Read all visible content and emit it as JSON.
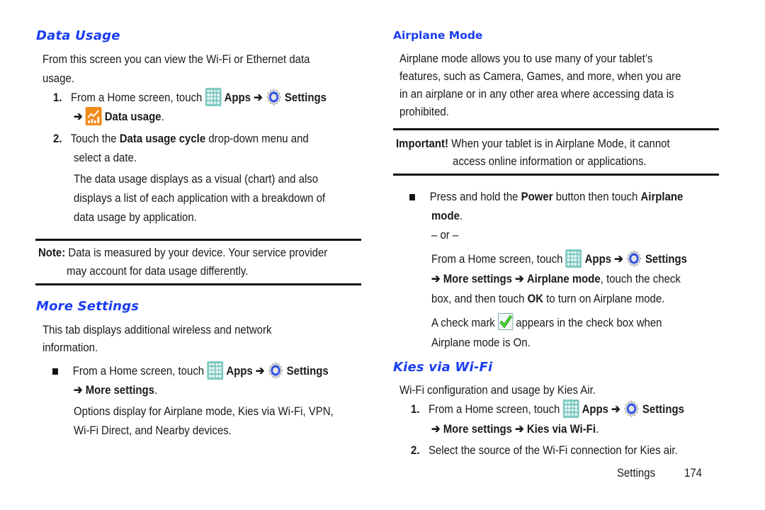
{
  "left": {
    "data_usage": {
      "heading": "Data Usage",
      "intro_line1": "From this screen you can view the Wi-Fi or Ethernet data",
      "intro_line2": "usage.",
      "step1": {
        "num": "1.",
        "pre": "From a Home screen, touch",
        "apps": "Apps",
        "arrow": "➔",
        "settings": "Settings",
        "data_usage": "Data usage",
        "period": "."
      },
      "step2": {
        "num": "2.",
        "pre": "Touch the",
        "bold": "Data usage cycle",
        "post": "drop-down menu and",
        "line2": "select a date."
      },
      "para_lines": [
        "The data usage displays as a visual (chart) and also",
        "displays a list of each application with a breakdown of",
        "data usage by application."
      ]
    },
    "note": {
      "label": "Note:",
      "line1": "Data is measured by your device. Your service provider",
      "line2": "may account for data usage differently."
    },
    "more_settings": {
      "heading": "More Settings",
      "intro_line1": "This tab displays additional wireless and network",
      "intro_line2": "information.",
      "bullet": {
        "pre": "From a Home screen, touch",
        "apps": "Apps",
        "arrow": "➔",
        "settings": "Settings",
        "more": "More settings",
        "period": "."
      },
      "para_lines": [
        "Options display for Airplane mode, Kies via Wi-Fi, VPN,",
        "Wi-Fi Direct, and Nearby devices."
      ]
    }
  },
  "right": {
    "airplane": {
      "heading": "Airplane Mode",
      "para_lines": [
        "Airplane mode allows you to use many of your tablet’s",
        "features, such as Camera, Games, and more, when you are",
        "in an airplane or in any other area where accessing data is",
        "prohibited."
      ]
    },
    "important": {
      "label": "Important!",
      "line1": "When your tablet is in Airplane Mode, it cannot",
      "line2": "access online information or applications."
    },
    "bullet": {
      "pre": "Press and hold the",
      "power": "Power",
      "mid": "button then touch",
      "airplane": "Airplane",
      "mode": "mode",
      "period": "."
    },
    "or": "– or –",
    "alt": {
      "pre": "From a Home screen, touch",
      "apps": "Apps",
      "arrow": "➔",
      "settings": "Settings",
      "more": "More settings",
      "airplane_mode": "Airplane mode",
      "post": ", touch the check",
      "line3_pre": "box, and then touch",
      "ok": "OK",
      "line3_post": "to turn on Airplane mode."
    },
    "check": {
      "pre": "A check mark",
      "post": "appears in the check box when",
      "line2": "Airplane mode is On."
    },
    "kies": {
      "heading": "Kies via Wi-Fi",
      "intro": "Wi-Fi configuration and usage by Kies Air.",
      "step1": {
        "num": "1.",
        "pre": "From a Home screen, touch",
        "apps": "Apps",
        "arrow": "➔",
        "settings": "Settings",
        "more": "More settings",
        "kies": "Kies via Wi-Fi",
        "period": "."
      },
      "step2": {
        "num": "2.",
        "text": "Select the source of the Wi-Fi connection for Kies air."
      }
    }
  },
  "footer": {
    "section": "Settings",
    "page": "174"
  }
}
